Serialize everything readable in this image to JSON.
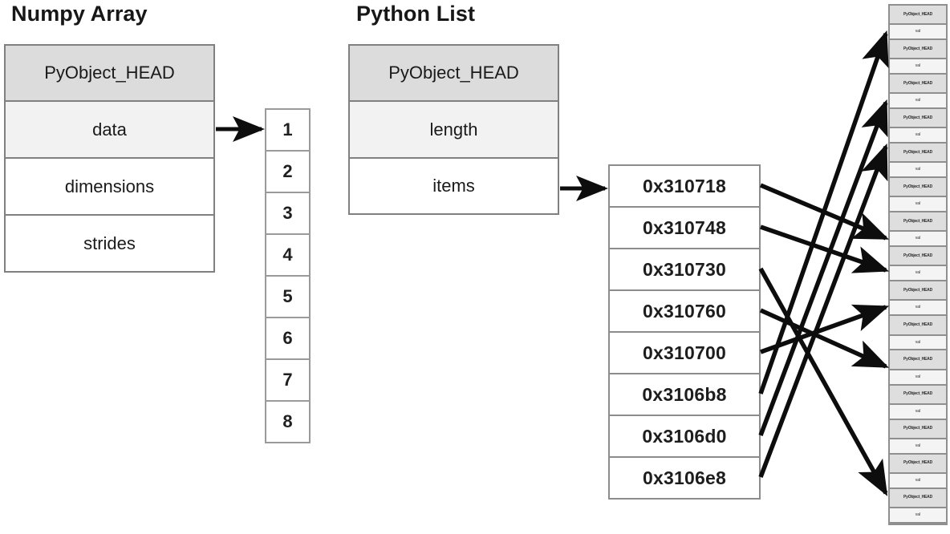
{
  "diagram": {
    "caption_numpy": "Numpy Array",
    "caption_list": "Python List"
  },
  "numpy_struct": {
    "title": "Numpy Array",
    "fields": [
      {
        "label": "PyObject_HEAD",
        "style": "head"
      },
      {
        "label": "data",
        "style": "highlight"
      },
      {
        "label": "dimensions",
        "style": "plain"
      },
      {
        "label": "strides",
        "style": "plain"
      }
    ]
  },
  "numpy_data_block": {
    "values": [
      "1",
      "2",
      "3",
      "4",
      "5",
      "6",
      "7",
      "8"
    ]
  },
  "list_struct": {
    "title": "Python List",
    "fields": [
      {
        "label": "PyObject_HEAD",
        "style": "head"
      },
      {
        "label": "length",
        "style": "highlight"
      },
      {
        "label": "items",
        "style": "plain"
      }
    ]
  },
  "pointer_block": {
    "addresses": [
      "0x310718",
      "0x310748",
      "0x310730",
      "0x310760",
      "0x310700",
      "0x3106b8",
      "0x3106d0",
      "0x3106e8"
    ]
  },
  "object_stack": {
    "head_label": "PyObject_HEAD",
    "value_label": "val",
    "object_count": 15
  },
  "arrows": {
    "data_to_block_label": "data-pointer-arrow",
    "items_to_pointers_label": "items-pointer-arrow",
    "pointer_links_label": "pointer-to-object-arrow",
    "pointer_link_count": 8
  },
  "colors": {
    "header_fill": "#dcdcdc",
    "highlight_fill": "#f2f2f2",
    "border": "#808080",
    "arrow": "#0d0d0d",
    "background": "#ffffff",
    "text": "#1a1a1a"
  }
}
